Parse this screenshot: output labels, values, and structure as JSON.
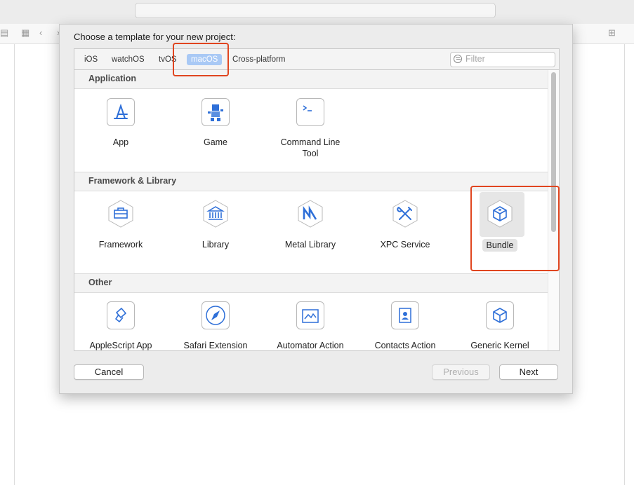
{
  "dialog": {
    "title": "Choose a template for your new project:",
    "tabs": [
      {
        "label": "iOS"
      },
      {
        "label": "watchOS"
      },
      {
        "label": "tvOS"
      },
      {
        "label": "macOS",
        "selected": true
      },
      {
        "label": "Cross-platform"
      }
    ],
    "filter_placeholder": "Filter",
    "sections": [
      {
        "title": "Application",
        "items": [
          {
            "label": "App",
            "icon": "app-store-icon"
          },
          {
            "label": "Game",
            "icon": "game-character-icon"
          },
          {
            "label": "Command Line Tool",
            "icon": "terminal-icon"
          }
        ]
      },
      {
        "title": "Framework & Library",
        "items": [
          {
            "label": "Framework",
            "icon": "toolbox-icon"
          },
          {
            "label": "Library",
            "icon": "library-building-icon"
          },
          {
            "label": "Metal Library",
            "icon": "metal-icon"
          },
          {
            "label": "XPC Service",
            "icon": "wrench-screwdriver-icon"
          },
          {
            "label": "Bundle",
            "icon": "bundle-cube-icon",
            "selected": true
          }
        ]
      },
      {
        "title": "Other",
        "items": [
          {
            "label": "AppleScript App",
            "icon": "applescript-icon"
          },
          {
            "label": "Safari Extension",
            "icon": "compass-icon"
          },
          {
            "label": "Automator Action",
            "icon": "automator-icon"
          },
          {
            "label": "Contacts Action",
            "icon": "contacts-icon"
          },
          {
            "label": "Generic Kernel",
            "icon": "kernel-cube-icon"
          }
        ]
      }
    ],
    "buttons": {
      "cancel": "Cancel",
      "previous": "Previous",
      "next": "Next"
    }
  },
  "colors": {
    "accent": "#2e6fd8",
    "tab_selected": "#a9c9f5",
    "annotation": "#e0451f"
  }
}
